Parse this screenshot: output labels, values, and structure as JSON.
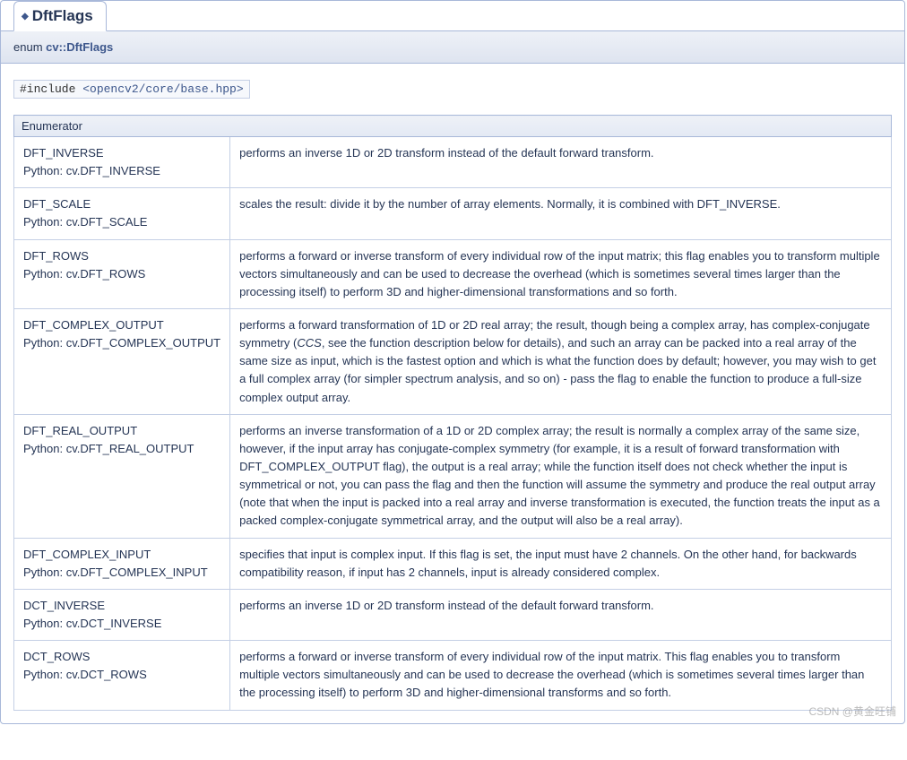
{
  "tab": {
    "label": "DftFlags"
  },
  "signature": {
    "prefix": "enum ",
    "qualified": "cv::DftFlags"
  },
  "include": {
    "kw": "#include ",
    "path": "<opencv2/core/base.hpp>"
  },
  "table": {
    "header": "Enumerator",
    "rows": [
      {
        "cname": "DFT_INVERSE",
        "py_prefix": "Python: ",
        "pyname": "cv.DFT_INVERSE",
        "desc": "performs an inverse 1D or 2D transform instead of the default forward transform."
      },
      {
        "cname": "DFT_SCALE",
        "py_prefix": "Python: ",
        "pyname": "cv.DFT_SCALE",
        "desc": "scales the result: divide it by the number of array elements. Normally, it is combined with DFT_INVERSE."
      },
      {
        "cname": "DFT_ROWS",
        "py_prefix": "Python: ",
        "pyname": "cv.DFT_ROWS",
        "desc": "performs a forward or inverse transform of every individual row of the input matrix; this flag enables you to transform multiple vectors simultaneously and can be used to decrease the overhead (which is sometimes several times larger than the processing itself) to perform 3D and higher-dimensional transformations and so forth."
      },
      {
        "cname": "DFT_COMPLEX_OUTPUT",
        "py_prefix": "Python: ",
        "pyname": "cv.DFT_COMPLEX_OUTPUT",
        "desc_pre": "performs a forward transformation of 1D or 2D real array; the result, though being a complex array, has complex-conjugate symmetry (",
        "desc_em": "CCS",
        "desc_post": ", see the function description below for details), and such an array can be packed into a real array of the same size as input, which is the fastest option and which is what the function does by default; however, you may wish to get a full complex array (for simpler spectrum analysis, and so on) - pass the flag to enable the function to produce a full-size complex output array."
      },
      {
        "cname": "DFT_REAL_OUTPUT",
        "py_prefix": "Python: ",
        "pyname": "cv.DFT_REAL_OUTPUT",
        "desc": "performs an inverse transformation of a 1D or 2D complex array; the result is normally a complex array of the same size, however, if the input array has conjugate-complex symmetry (for example, it is a result of forward transformation with DFT_COMPLEX_OUTPUT flag), the output is a real array; while the function itself does not check whether the input is symmetrical or not, you can pass the flag and then the function will assume the symmetry and produce the real output array (note that when the input is packed into a real array and inverse transformation is executed, the function treats the input as a packed complex-conjugate symmetrical array, and the output will also be a real array)."
      },
      {
        "cname": "DFT_COMPLEX_INPUT",
        "py_prefix": "Python: ",
        "pyname": "cv.DFT_COMPLEX_INPUT",
        "desc": "specifies that input is complex input. If this flag is set, the input must have 2 channels. On the other hand, for backwards compatibility reason, if input has 2 channels, input is already considered complex."
      },
      {
        "cname": "DCT_INVERSE",
        "py_prefix": "Python: ",
        "pyname": "cv.DCT_INVERSE",
        "desc": "performs an inverse 1D or 2D transform instead of the default forward transform."
      },
      {
        "cname": "DCT_ROWS",
        "py_prefix": "Python: ",
        "pyname": "cv.DCT_ROWS",
        "desc": "performs a forward or inverse transform of every individual row of the input matrix. This flag enables you to transform multiple vectors simultaneously and can be used to decrease the overhead (which is sometimes several times larger than the processing itself) to perform 3D and higher-dimensional transforms and so forth."
      }
    ]
  },
  "watermark": "CSDN @黄金旺铺"
}
